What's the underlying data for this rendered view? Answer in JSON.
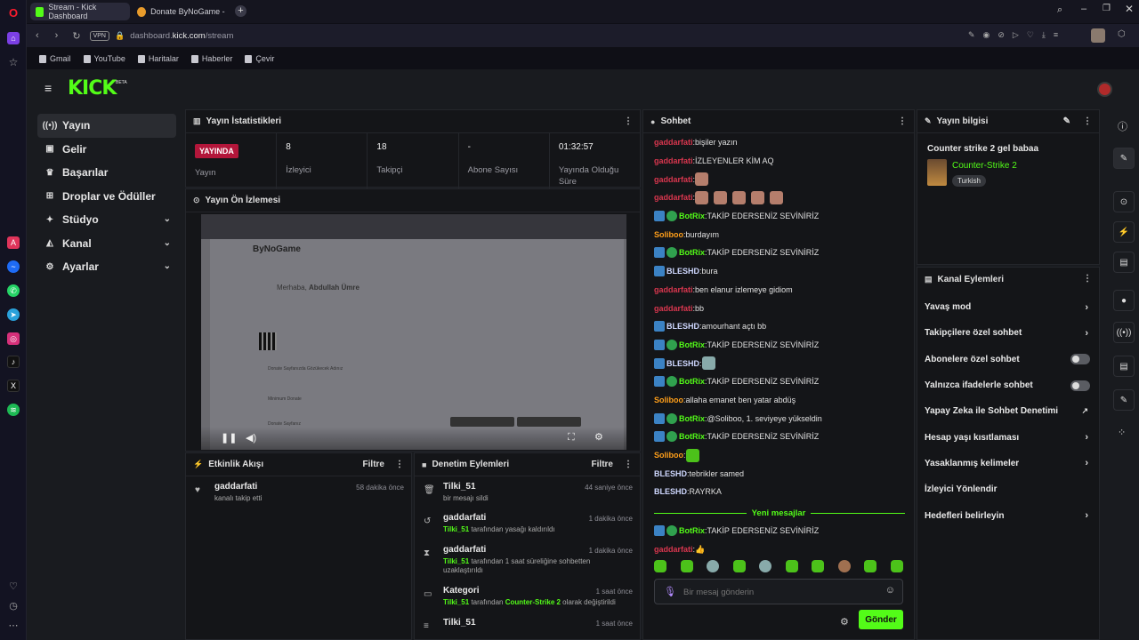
{
  "browser": {
    "tabs": [
      {
        "label": "Stream - Kick Dashboard",
        "active": true
      },
      {
        "label": "Donate ByNoGame - Stre",
        "active": false
      }
    ],
    "vpn_label": "VPN",
    "url_prefix": "dashboard.",
    "url_domain": "kick.com",
    "url_path": "/stream",
    "bookmarks": [
      "Gmail",
      "YouTube",
      "Haritalar",
      "Haberler",
      "Çevir"
    ]
  },
  "app": {
    "logo": "KICK",
    "logo_beta": "BETA",
    "accent": "#53fc18"
  },
  "nav": {
    "items": [
      {
        "label": "Yayın",
        "icon": "broadcast-icon",
        "active": true,
        "chevron": false
      },
      {
        "label": "Gelir",
        "icon": "wallet-icon",
        "active": false,
        "chevron": false
      },
      {
        "label": "Başarılar",
        "icon": "trophy-icon",
        "active": false,
        "chevron": false
      },
      {
        "label": "Droplar ve Ödüller",
        "icon": "gift-icon",
        "active": false,
        "chevron": false
      },
      {
        "label": "Stüdyo",
        "icon": "studio-icon",
        "active": false,
        "chevron": true
      },
      {
        "label": "Kanal",
        "icon": "channel-icon",
        "active": false,
        "chevron": true
      },
      {
        "label": "Ayarlar",
        "icon": "gear-icon",
        "active": false,
        "chevron": true
      }
    ]
  },
  "stats_panel": {
    "title": "Yayın İstatistikleri",
    "live_badge": "YAYINDA",
    "live_label": "Yayın",
    "stats": [
      {
        "value": "8",
        "label": "İzleyici"
      },
      {
        "value": "18",
        "label": "Takipçi"
      },
      {
        "value": "-",
        "label": "Abone Sayısı"
      },
      {
        "value": "01:32:57",
        "label": "Yayında Olduğu Süre"
      }
    ]
  },
  "preview_panel": {
    "title": "Yayın Ön İzlemesi",
    "inner": {
      "brand": "ByNoGame",
      "greeting": "Merhaba, ",
      "user": "Abdullah Ümre",
      "sections": [
        "Donate Sayfanızda Gözükecek Adınız",
        "Minimum Donate",
        "Donate Sayfanız"
      ]
    }
  },
  "activity_panel": {
    "title": "Etkinlik Akışı",
    "filter": "Filtre",
    "items": [
      {
        "name": "gaddarfati",
        "desc": "kanalı takip etti",
        "time": "58 dakika önce"
      }
    ]
  },
  "moderation_panel": {
    "title": "Denetim Eylemleri",
    "filter": "Filtre",
    "items": [
      {
        "name": "Tilki_51",
        "desc_pre": "",
        "desc_user": "",
        "desc_post": "bir mesajı sildi",
        "desc_user2": "",
        "desc_post2": "",
        "time": "44 saniye önce",
        "icon": "trash-icon"
      },
      {
        "name": "gaddarfati",
        "desc_pre": "",
        "desc_user": "Tilki_51",
        "desc_post": " tarafından yasağı kaldırıldı",
        "desc_user2": "",
        "desc_post2": "",
        "time": "1 dakika önce",
        "icon": "undo-icon"
      },
      {
        "name": "gaddarfati",
        "desc_pre": "",
        "desc_user": "Tilki_51",
        "desc_post": " tarafından 1 saat süreliğine sohbetten uzaklaştırıldı",
        "desc_user2": "",
        "desc_post2": "",
        "time": "1 dakika önce",
        "icon": "hourglass-icon"
      },
      {
        "name": "Kategori",
        "desc_pre": "",
        "desc_user": "Tilki_51",
        "desc_post": " tarafından ",
        "desc_user2": "Counter-Strike 2",
        "desc_post2": " olarak değiştirildi",
        "time": "1 saat önce",
        "icon": "category-icon"
      },
      {
        "name": "Tilki_51",
        "desc_pre": "",
        "desc_user": "",
        "desc_post": "",
        "desc_user2": "",
        "desc_post2": "",
        "time": "1 saat önce",
        "icon": "list-icon"
      }
    ]
  },
  "chat_panel": {
    "title": "Sohbet",
    "new_messages": "Yeni mesajlar",
    "messages": [
      {
        "user": "gaddarfati",
        "color": "red",
        "bot": false,
        "text": "bişiler yazın",
        "emotes": 0
      },
      {
        "user": "gaddarfati",
        "color": "red",
        "bot": false,
        "text": "İZLEYENLER KİM AQ",
        "emotes": 0
      },
      {
        "user": "gaddarfati",
        "color": "red",
        "bot": false,
        "text": "",
        "emotes": 1
      },
      {
        "user": "gaddarfati",
        "color": "red",
        "bot": false,
        "text": "",
        "emotes": 5
      },
      {
        "user": "BotRix",
        "color": "green",
        "bot": true,
        "text": "TAKİP EDERSENİZ SEVİNİRİZ",
        "emotes": 0
      },
      {
        "user": "Soliboo",
        "color": "orange",
        "bot": false,
        "text": "burdayım",
        "emotes": 0
      },
      {
        "user": "BotRix",
        "color": "green",
        "bot": true,
        "text": "TAKİP EDERSENİZ SEVİNİRİZ",
        "emotes": 0
      },
      {
        "user": "BLESHD",
        "color": "blue",
        "bot": false,
        "badge": true,
        "text": "bura",
        "emotes": 0
      },
      {
        "user": "gaddarfati",
        "color": "red",
        "bot": false,
        "text": "ben elanur izlemeye gidiom",
        "emotes": 0
      },
      {
        "user": "gaddarfati",
        "color": "red",
        "bot": false,
        "text": "bb",
        "emotes": 0
      },
      {
        "user": "BLESHD",
        "color": "blue",
        "bot": false,
        "badge": true,
        "text": "amourhant açtı bb",
        "emotes": 0
      },
      {
        "user": "BotRix",
        "color": "green",
        "bot": true,
        "text": "TAKİP EDERSENİZ SEVİNİRİZ",
        "emotes": 0
      },
      {
        "user": "BLESHD",
        "color": "blue",
        "bot": false,
        "badge": true,
        "text": "",
        "emotes": 1
      },
      {
        "user": "BotRix",
        "color": "green",
        "bot": true,
        "text": "TAKİP EDERSENİZ SEVİNİRİZ",
        "emotes": 0
      },
      {
        "user": "Soliboo",
        "color": "orange",
        "bot": false,
        "text": "allaha emanet ben yatar abdüş",
        "emotes": 0
      },
      {
        "user": "BotRix",
        "color": "green",
        "bot": true,
        "text": "@Soliboo, 1. seviyeye yükseldin",
        "emotes": 0
      },
      {
        "user": "BotRix",
        "color": "green",
        "bot": true,
        "text": "TAKİP EDERSENİZ SEVİNİRİZ",
        "emotes": 0
      },
      {
        "user": "Soliboo",
        "color": "orange",
        "bot": false,
        "text": "",
        "emotes": 1
      },
      {
        "user": "BLESHD",
        "color": "blue",
        "bot": false,
        "text": "tebrikler samed",
        "emotes": 0
      },
      {
        "user": "BLESHD",
        "color": "blue",
        "bot": false,
        "text": "RAYRKA",
        "emotes": 0
      }
    ],
    "after_messages": [
      {
        "user": "BotRix",
        "color": "green",
        "bot": true,
        "text": "TAKİP EDERSENİZ SEVİNİRİZ",
        "emotes": 0
      },
      {
        "user": "gaddarfati",
        "color": "red",
        "bot": false,
        "text": "👍",
        "emotes": 0
      }
    ],
    "input_placeholder": "Bir mesaj gönderin",
    "send_label": "Gönder"
  },
  "info_panel": {
    "title": "Yayın bilgisi",
    "stream_title": "Counter strike 2 gel babaa",
    "category": "Counter-Strike 2",
    "language": "Turkish"
  },
  "channel_actions": {
    "title": "Kanal Eylemleri",
    "items": [
      {
        "label": "Yavaş mod",
        "control": "arrow"
      },
      {
        "label": "Takipçilere özel sohbet",
        "control": "arrow"
      },
      {
        "label": "Abonelere özel sohbet",
        "control": "toggle"
      },
      {
        "label": "Yalnızca ifadelerle sohbet",
        "control": "toggle"
      },
      {
        "label": "Yapay Zeka ile Sohbet Denetimi",
        "control": "external"
      },
      {
        "label": "Hesap yaşı kısıtlaması",
        "control": "arrow"
      },
      {
        "label": "Yasaklanmış kelimeler",
        "control": "arrow"
      },
      {
        "label": "İzleyici Yönlendir",
        "control": "none"
      },
      {
        "label": "Hedefleri belirleyin",
        "control": "arrow"
      }
    ]
  }
}
